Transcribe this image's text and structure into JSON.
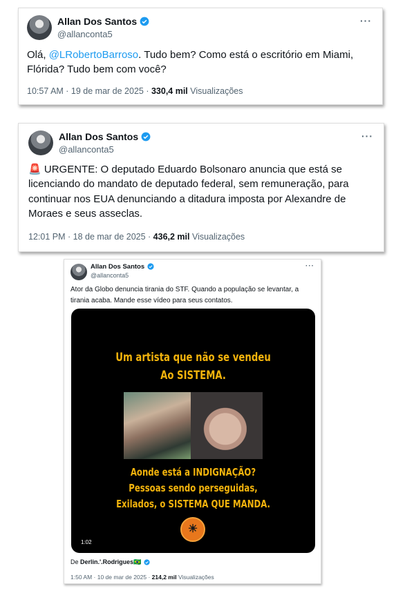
{
  "tweets": [
    {
      "name": "Allan Dos Santos",
      "handle": "@allanconta5",
      "more": "···",
      "text_prefix": "Olá, ",
      "mention": "@LRobertoBarroso",
      "text_suffix": ". Tudo bem? Como está o escritório em Miami, Flórida? Tudo bem com você?",
      "time": "10:57 AM · 19 de mar de 2025 · ",
      "views_count": "330,4 mil",
      "views_label": " Visualizações"
    },
    {
      "name": "Allan Dos Santos",
      "handle": "@allanconta5",
      "more": "···",
      "emoji": "🚨",
      "text": " URGENTE: O deputado Eduardo Bolsonaro anuncia que está se licenciando do mandato de deputado federal, sem remuneração, para continuar nos EUA denunciando a ditadura imposta por Alexandre de Moraes e seus asseclas.",
      "time": "12:01 PM · 18 de mar de 2025 · ",
      "views_count": "436,2 mil",
      "views_label": " Visualizações"
    },
    {
      "name": "Allan Dos Santos",
      "handle": "@allanconta5",
      "more": "···",
      "text": "Ator da Globo denuncia tirania do STF. Quando a população se levantar, a tirania acaba. Mande esse vídeo para seus contatos.",
      "video": {
        "caption_top_1": "Um artista que não se vendeu",
        "caption_top_2": "Ao SISTEMA.",
        "caption_bottom_1": "Aonde está a INDIGNAÇÃO?",
        "caption_bottom_2": "Pessoas sendo perseguidas,",
        "caption_bottom_3": "Exilados, o SISTEMA QUE MANDA.",
        "duration": "1:02"
      },
      "source_prefix": "De ",
      "source_name": "Derlin.'.Rodrigues",
      "source_flag": "🇧🇷",
      "time": "1:50 AM · 10 de mar de 2025 · ",
      "views_count": "214,2 mil",
      "views_label": " Visualizações"
    }
  ],
  "colors": {
    "accent": "#1d9bf0",
    "caption": "#f2b30c",
    "muted": "#536471"
  }
}
